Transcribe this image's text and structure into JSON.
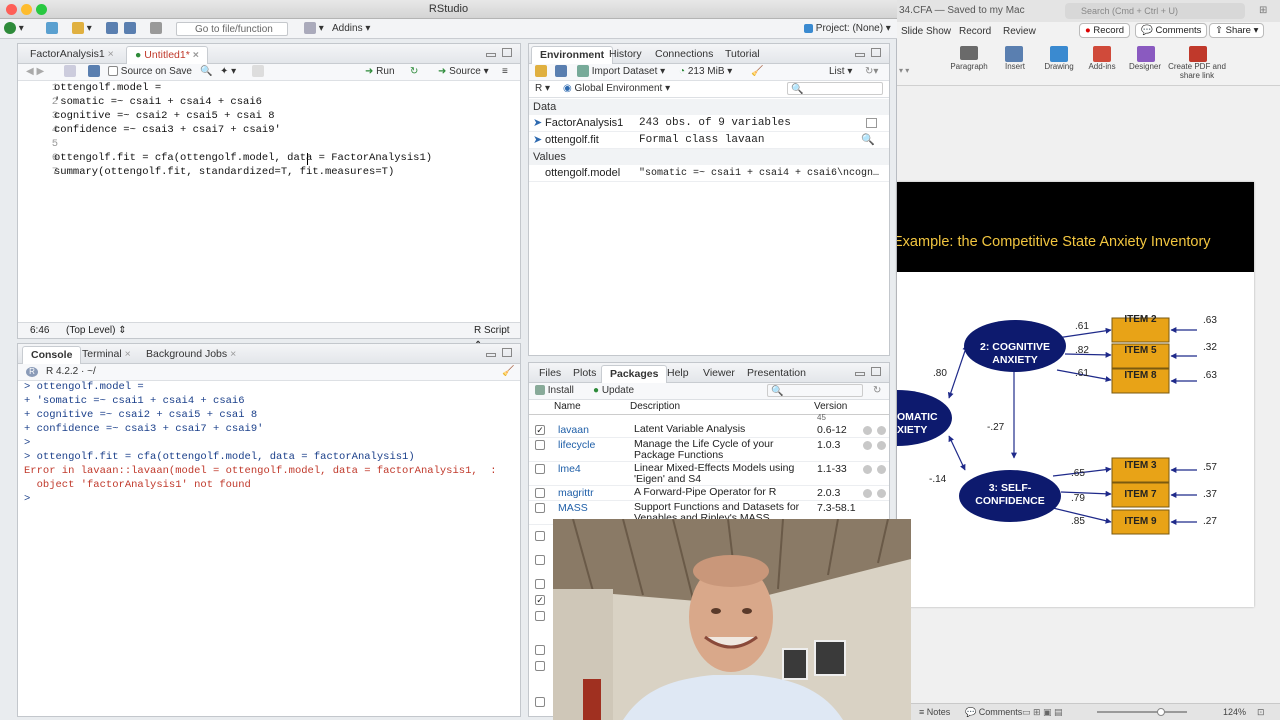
{
  "window": {
    "title": "RStudio"
  },
  "toolbar": {
    "goto_placeholder": "Go to file/function",
    "addins_label": "Addins",
    "project_label": "Project: (None)"
  },
  "source_pane": {
    "tabs": [
      "FactorAnalysis1",
      "Untitled1*"
    ],
    "source_on_save_label": "Source on Save",
    "run_label": "Run",
    "source_label": "Source",
    "lines": [
      {
        "n": "1",
        "text": "ottengolf.model ="
      },
      {
        "n": "2",
        "text": "'somatic =~ csai1 + csai4 + csai6"
      },
      {
        "n": "3",
        "text": "cognitive =~ csai2 + csai5 + csai 8"
      },
      {
        "n": "4",
        "text": "confidence =~ csai3 + csai7 + csai9'"
      },
      {
        "n": "5",
        "text": ""
      },
      {
        "n": "6",
        "text": "ottengolf.fit = cfa(ottengolf.model, data = FactorAnalysis1)"
      },
      {
        "n": "7",
        "text": "summary(ottengolf.fit, standardized=T, fit.measures=T)"
      }
    ],
    "cursor_pos": "6:46",
    "scope": "(Top Level)",
    "file_type": "R Script"
  },
  "console_pane": {
    "tabs": [
      "Console",
      "Terminal",
      "Background Jobs"
    ],
    "r_version": "R 4.2.2 · ~/",
    "lines": [
      {
        "text": "> ottengolf.model =",
        "err": false
      },
      {
        "text": "+ 'somatic =~ csai1 + csai4 + csai6",
        "err": false
      },
      {
        "text": "+ cognitive =~ csai2 + csai5 + csai 8",
        "err": false
      },
      {
        "text": "+ confidence =~ csai3 + csai7 + csai9'",
        "err": false
      },
      {
        "text": ">",
        "err": false
      },
      {
        "text": "> ottengolf.fit = cfa(ottengolf.model, data = factorAnalysis1)",
        "err": false
      },
      {
        "text": "Error in lavaan::lavaan(model = ottengolf.model, data = factorAnalysis1,  :",
        "err": true
      },
      {
        "text": "  object 'factorAnalysis1' not found",
        "err": true
      },
      {
        "text": ">",
        "err": false
      }
    ]
  },
  "env_pane": {
    "tabs": [
      "Environment",
      "History",
      "Connections",
      "Tutorial"
    ],
    "import_label": "Import Dataset",
    "memory": "213 MiB",
    "list_label": "List",
    "lang": "R",
    "scope": "Global Environment",
    "data_header": "Data",
    "values_header": "Values",
    "data": [
      {
        "name": "FactorAnalysis1",
        "value": "243 obs. of 9 variables"
      },
      {
        "name": "ottengolf.fit",
        "value": "Formal class  lavaan"
      }
    ],
    "values": [
      {
        "name": "ottengolf.model",
        "value": "\"somatic =~ csai1 + csai4 + csai6\\ncogn…"
      }
    ]
  },
  "packages_pane": {
    "tabs": [
      "Files",
      "Plots",
      "Packages",
      "Help",
      "Viewer",
      "Presentation"
    ],
    "install_label": "Install",
    "update_label": "Update",
    "columns": [
      "Name",
      "Description",
      "Version"
    ],
    "partial_version": "45",
    "rows": [
      {
        "checked": true,
        "name": "lavaan",
        "desc": "Latent Variable Analysis",
        "ver": "0.6-12"
      },
      {
        "checked": false,
        "name": "lifecycle",
        "desc": "Manage the Life Cycle of your Package Functions",
        "ver": "1.0.3"
      },
      {
        "checked": false,
        "name": "lme4",
        "desc": "Linear Mixed-Effects Models using 'Eigen' and S4",
        "ver": "1.1-33"
      },
      {
        "checked": false,
        "name": "magrittr",
        "desc": "A Forward-Pipe Operator for R",
        "ver": "2.0.3"
      },
      {
        "checked": false,
        "name": "MASS",
        "desc": "Support Functions and Datasets for Venables and Ripley's MASS",
        "ver": "7.3-58.1"
      }
    ]
  },
  "ppt": {
    "title": "34.CFA — Saved to my Mac",
    "search_placeholder": "Search (Cmd + Ctrl + U)",
    "tabs": [
      "Slide Show",
      "Record",
      "Review"
    ],
    "record_label": "Record",
    "comments_label": "Comments",
    "share_label": "Share",
    "ribbon": [
      "Paragraph",
      "Insert",
      "Drawing",
      "Add-ins",
      "Designer",
      "Create PDF and share link"
    ],
    "slide_title": "Example: the Competitive State Anxiety Inventory",
    "status": {
      "notes": "Notes",
      "comments": "Comments",
      "zoom": "124%"
    },
    "diagram": {
      "factors": [
        "2: COGNITIVE ANXIETY",
        "3: SELF-CONFIDENCE",
        "OMATIC XIETY"
      ],
      "items": [
        "ITEM 2",
        "ITEM 5",
        "ITEM 8",
        "ITEM 3",
        "ITEM 7",
        "ITEM 9"
      ],
      "loadings": [
        ".61",
        ".82",
        ".61",
        ".65",
        ".79",
        ".85"
      ],
      "errors": [
        ".63",
        ".32",
        ".63",
        ".57",
        ".37",
        ".27"
      ],
      "correlations": [
        ".80",
        "-.27",
        "-.14"
      ]
    }
  },
  "colors": {
    "accent": "#1f5fa8",
    "error": "#c0392b",
    "string": "#1a7a1a",
    "slide_header": "#000000",
    "slide_title": "#f2c640",
    "factor": "#0d1a6e",
    "item": "#e8a317"
  }
}
